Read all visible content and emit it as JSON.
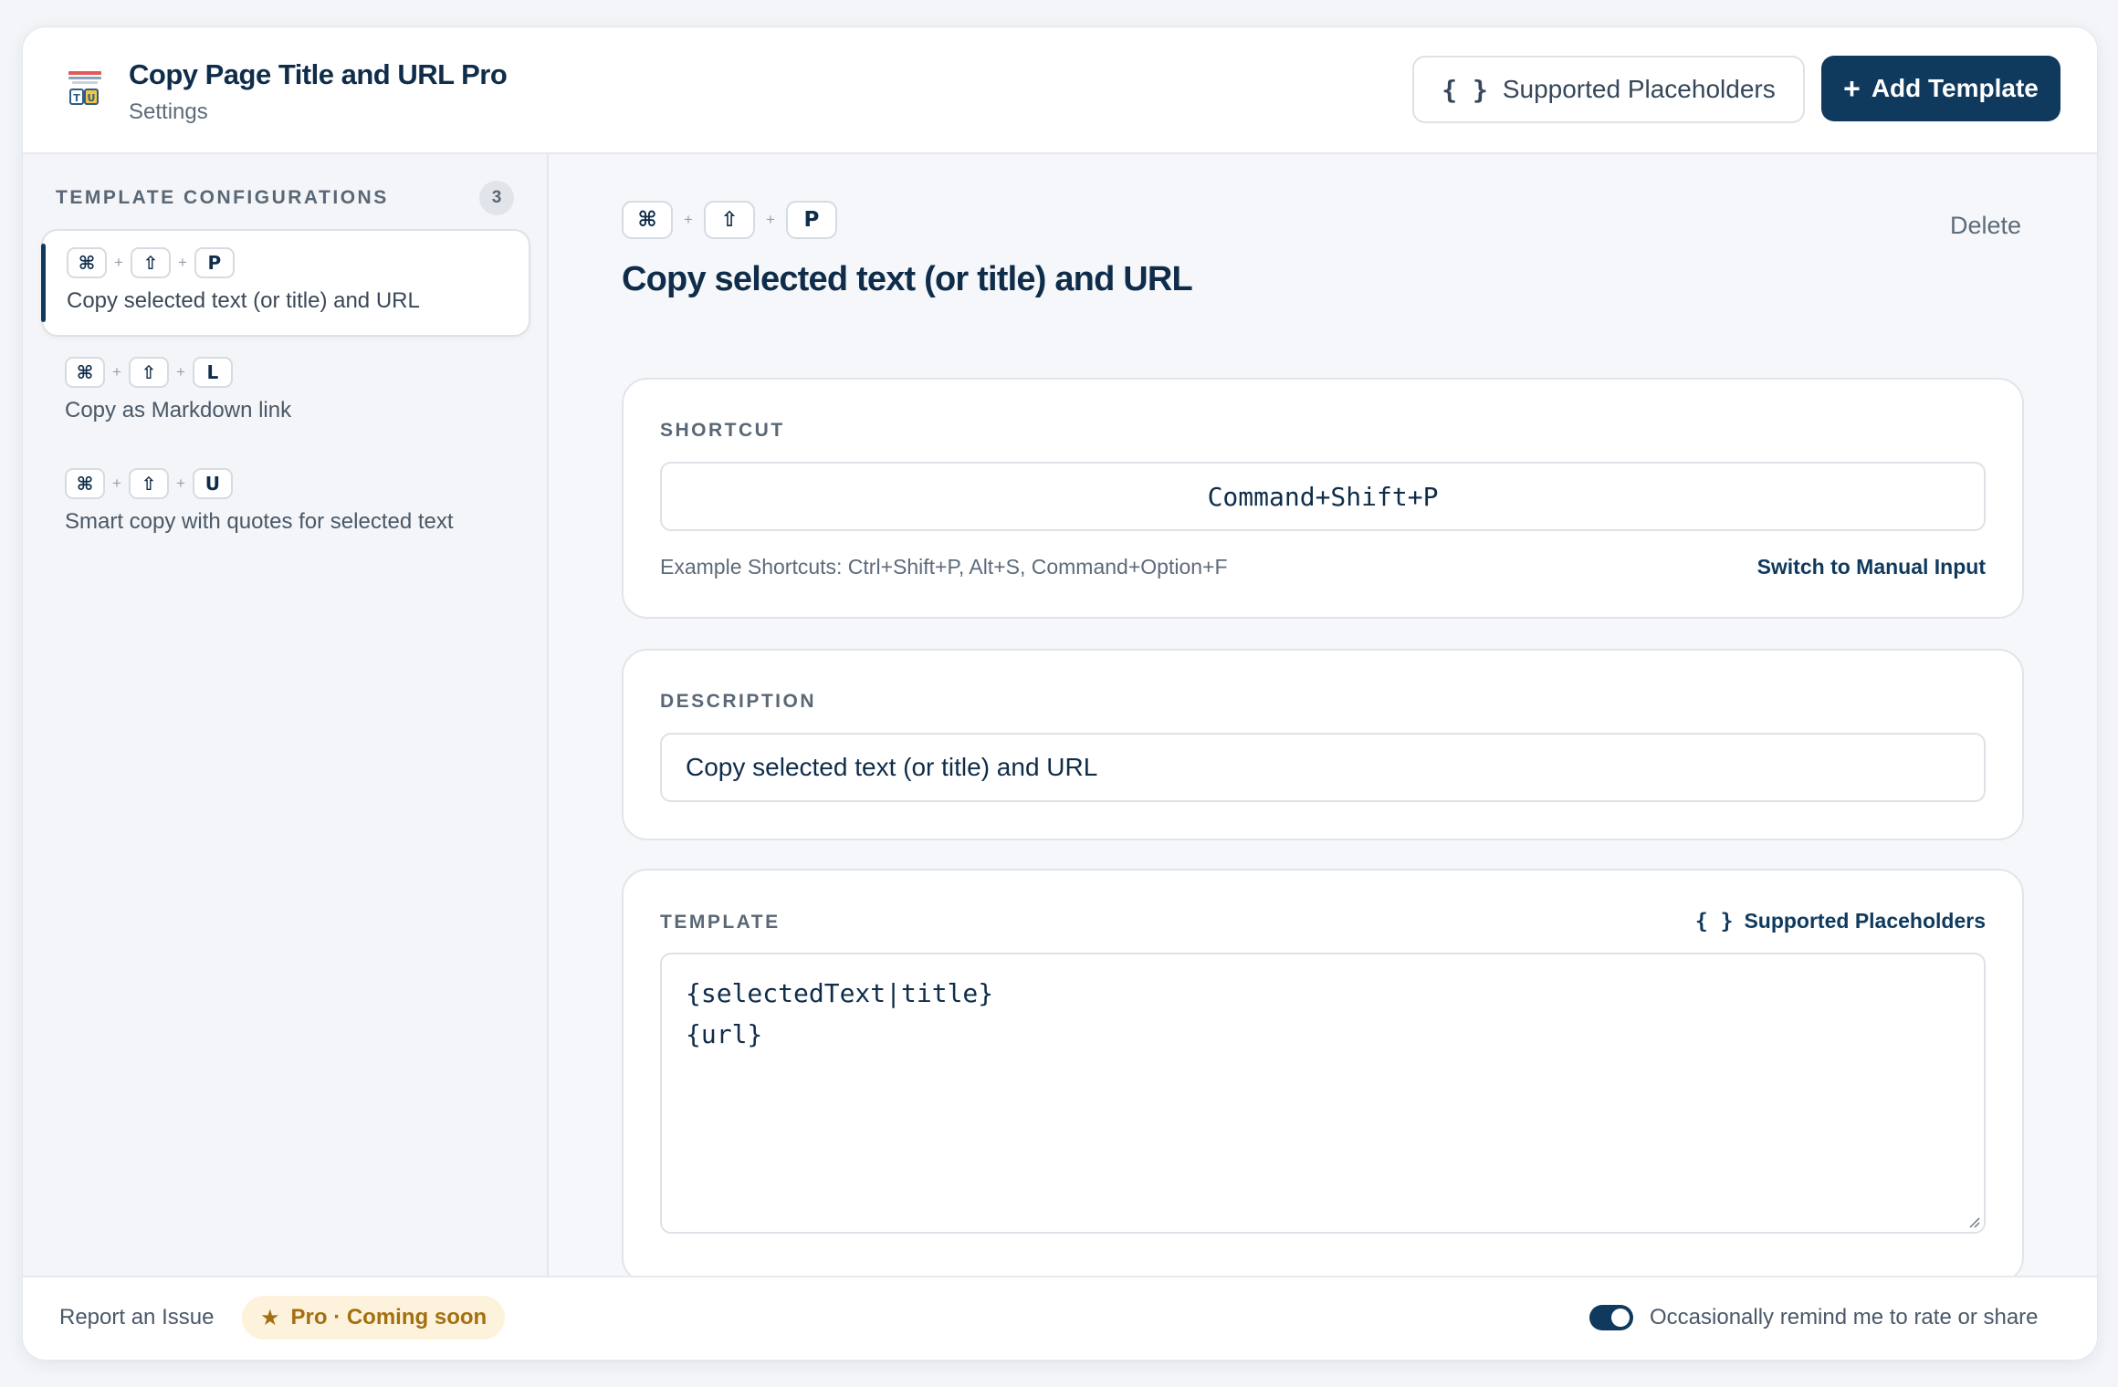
{
  "header": {
    "app_title": "Copy Page Title and URL Pro",
    "app_subtitle": "Settings",
    "placeholders_button": {
      "icon": "{ }",
      "label": "Supported Placeholders"
    },
    "add_button": {
      "icon": "+",
      "label": "Add Template"
    }
  },
  "sidebar": {
    "heading": "TEMPLATE CONFIGURATIONS",
    "count": "3",
    "items": [
      {
        "keys": [
          "⌘",
          "⇧",
          "P"
        ],
        "label": "Copy selected text (or title) and URL",
        "active": true
      },
      {
        "keys": [
          "⌘",
          "⇧",
          "L"
        ],
        "label": "Copy as Markdown link",
        "active": false
      },
      {
        "keys": [
          "⌘",
          "⇧",
          "U"
        ],
        "label": "Smart copy with quotes for selected text",
        "active": false
      }
    ],
    "plus": "+"
  },
  "main": {
    "keys": [
      "⌘",
      "⇧",
      "P"
    ],
    "delete_label": "Delete",
    "title": "Copy selected text (or title) and URL",
    "shortcut": {
      "label": "SHORTCUT",
      "value": "Command+Shift+P",
      "hint": "Example Shortcuts: Ctrl+Shift+P, Alt+S, Command+Option+F",
      "switch_label": "Switch to Manual Input"
    },
    "description": {
      "label": "DESCRIPTION",
      "value": "Copy selected text (or title) and URL"
    },
    "template": {
      "label": "TEMPLATE",
      "link_icon": "{ }",
      "link_label": "Supported Placeholders",
      "line1": "{selectedText|title}",
      "line2": "{url}"
    }
  },
  "footer": {
    "report_label": "Report an Issue",
    "pro_icon": "★",
    "pro_label": "Pro · Coming soon",
    "remind_label": "Occasionally remind me to rate or share",
    "remind_on": true
  },
  "colors": {
    "primary": "#0f3a5e",
    "text": "#0f2d4a",
    "muted": "#5d6b7a",
    "pro_bg": "#fdf3dc",
    "pro_text": "#a46f10"
  }
}
